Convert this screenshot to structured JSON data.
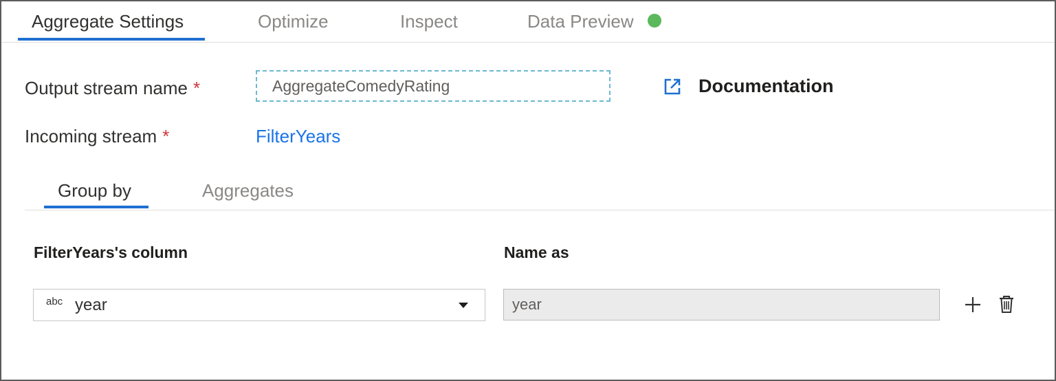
{
  "tabs": [
    {
      "label": "Aggregate Settings",
      "active": true
    },
    {
      "label": "Optimize",
      "active": false
    },
    {
      "label": "Inspect",
      "active": false
    },
    {
      "label": "Data Preview",
      "active": false
    }
  ],
  "status_color": "#5cb85c",
  "form": {
    "output_stream_label": "Output stream name",
    "required_mark": "*",
    "output_stream_value": "AggregateComedyRating",
    "incoming_stream_label": "Incoming stream",
    "incoming_stream_value": "FilterYears",
    "documentation_label": "Documentation"
  },
  "sub_tabs": [
    {
      "label": "Group by",
      "active": true
    },
    {
      "label": "Aggregates",
      "active": false
    }
  ],
  "group_by": {
    "column_header": "FilterYears's column",
    "name_header": "Name as",
    "rows": [
      {
        "type_tag": "abc",
        "column": "year",
        "name_as": "year"
      }
    ]
  },
  "icons": {
    "documentation": "external-link-icon",
    "add": "plus-icon",
    "delete": "trash-icon",
    "dropdown": "caret-down-icon",
    "status": "status-dot-icon"
  },
  "colors": {
    "accent": "#1f6fd1",
    "link": "#1a73e8",
    "required": "#d13438"
  }
}
